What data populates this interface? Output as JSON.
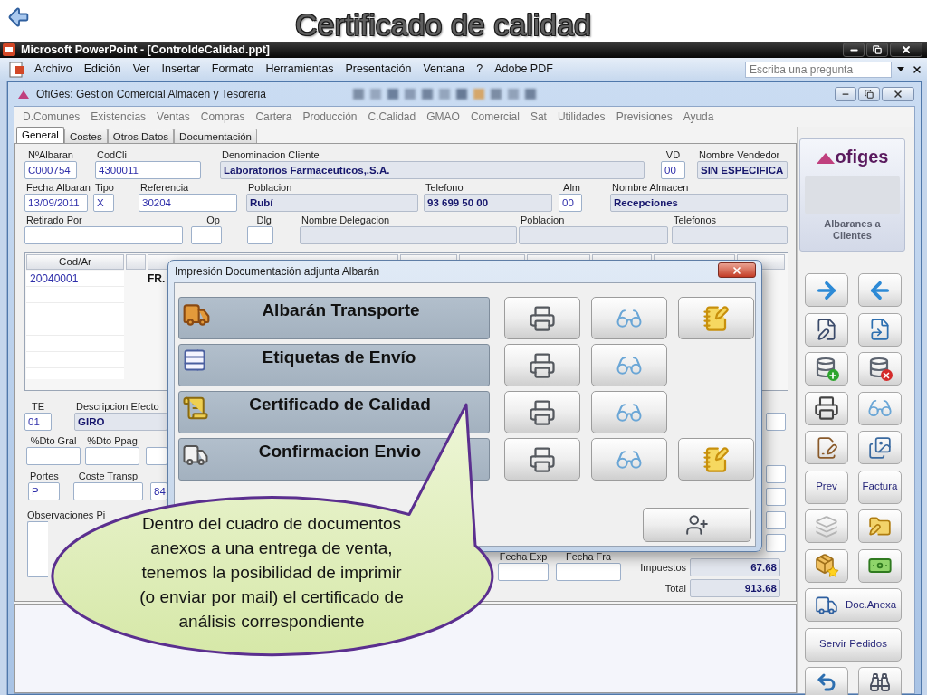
{
  "slide": {
    "title": "Certificado de calidad"
  },
  "powerpoint": {
    "title": "Microsoft PowerPoint - [ControldeCalidad.ppt]",
    "menu": [
      "Archivo",
      "Edición",
      "Ver",
      "Insertar",
      "Formato",
      "Herramientas",
      "Presentación",
      "Ventana",
      "?",
      "Adobe PDF"
    ],
    "question_box": {
      "placeholder": "Escriba una pregunta"
    }
  },
  "ofiges": {
    "title": "OfiGes: Gestion Comercial Almacen y Tesoreria",
    "menu": [
      "D.Comunes",
      "Existencias",
      "Ventas",
      "Compras",
      "Cartera",
      "Producción",
      "C.Calidad",
      "GMAO",
      "Comercial",
      "Sat",
      "Utilidades",
      "Previsiones",
      "Ayuda"
    ],
    "tabs": [
      {
        "label": "General",
        "selected": true
      },
      {
        "label": "Costes",
        "selected": false
      },
      {
        "label": "Otros Datos",
        "selected": false
      },
      {
        "label": "Documentación",
        "selected": false
      }
    ]
  },
  "header_fields": [
    [
      {
        "label": "NºAlbaran",
        "value": "C000754",
        "readonly": false
      },
      {
        "label": "CodCli",
        "value": "4300011",
        "readonly": false
      },
      {
        "label": "Denominacion Cliente",
        "value": "Laboratorios Farmaceuticos,.S.A.",
        "readonly": true
      },
      {
        "label": "VD",
        "value": "00",
        "readonly": false
      },
      {
        "label": "Nombre Vendedor",
        "value": "SIN ESPECIFICA",
        "readonly": true
      }
    ],
    [
      {
        "label": "Fecha Albaran",
        "value": "13/09/2011",
        "readonly": false
      },
      {
        "label": "Tipo",
        "value": "X",
        "readonly": false
      },
      {
        "label": "Referencia",
        "value": "30204",
        "readonly": false
      },
      {
        "label": "Poblacion",
        "value": "Rubí",
        "readonly": true
      },
      {
        "label": "Telefono",
        "value": "93 699 50 00",
        "readonly": true
      },
      {
        "label": "Alm",
        "value": "00",
        "readonly": false
      },
      {
        "label": "Nombre Almacen",
        "value": "Recepciones",
        "readonly": true
      }
    ],
    [
      {
        "label": "Retirado Por",
        "readonly": false
      },
      {
        "label": "Op",
        "readonly": false
      },
      {
        "label": "Dlg",
        "readonly": false
      },
      {
        "label": "Nombre Delegacion",
        "readonly": true
      },
      {
        "label": "Poblacion",
        "readonly": true
      },
      {
        "label": "Telefonos",
        "readonly": true
      }
    ]
  ],
  "lines_table": {
    "columns": [
      "Cod/Ar"
    ],
    "rows": [
      {
        "cod_ar": "20040001",
        "column_3": "FR."
      }
    ]
  },
  "payment_fields": [
    {
      "label": "TE",
      "value": "01",
      "readonly": false
    },
    {
      "label": "Descripcion Efecto",
      "value": "GIRO",
      "readonly": true
    }
  ],
  "discount_fields": [
    {
      "label": "%Dto Gral"
    },
    {
      "label": "%Dto Ppag"
    }
  ],
  "shipping_fields": [
    {
      "label": "Portes",
      "value": "P"
    },
    {
      "label": "Coste Transp"
    },
    {
      "value": "84"
    }
  ],
  "notes": {
    "label": "Observaciones Pi"
  },
  "date_fields": [
    {
      "label": "Fecha Exp"
    },
    {
      "label": "Fecha Fra"
    }
  ],
  "totals": [
    {
      "label": "Impuestos",
      "value": "67.68",
      "readonly": true
    },
    {
      "label": "Total",
      "value": "913.68",
      "readonly": true
    }
  ],
  "sidebar": {
    "logo": "ofiges",
    "caption": "Albaranes a Clientes",
    "text_buttons": [
      "Prev",
      "Factura"
    ],
    "wide_buttons": [
      "Doc.Anexa",
      "Servir Pedidos"
    ]
  },
  "dialog": {
    "title": "Impresión Documentación adjunta Albarán",
    "documents": [
      {
        "label": "Albarán Transporte",
        "actions": [
          {
            "kind": "print"
          },
          {
            "kind": "preview"
          },
          {
            "kind": "edit"
          }
        ]
      },
      {
        "label": "Etiquetas de Envío",
        "actions": [
          {
            "kind": "print"
          },
          {
            "kind": "preview"
          }
        ]
      },
      {
        "label": "Certificado de Calidad",
        "actions": [
          {
            "kind": "print"
          },
          {
            "kind": "preview"
          }
        ]
      },
      {
        "label": "Confirmacion Envio",
        "actions": [
          {
            "kind": "print"
          },
          {
            "kind": "preview"
          },
          {
            "kind": "edit"
          }
        ]
      }
    ]
  },
  "callout": {
    "text": "Dentro del cuadro de documentos anexos a una entrega de venta, tenemos la posibilidad de imprimir (o enviar por mail) el certificado de análisis correspondiente"
  }
}
